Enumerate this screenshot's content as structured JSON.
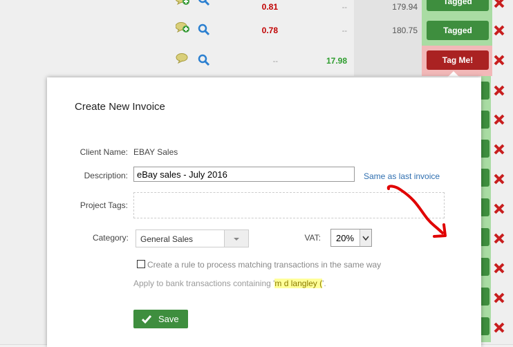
{
  "rows": [
    {
      "c1": "0.81",
      "c2": "--",
      "c3": "179.94",
      "tag": "Tagged"
    },
    {
      "c1": "0.78",
      "c2": "--",
      "c3": "180.75",
      "tag": "Tagged"
    },
    {
      "c1": "--",
      "c2": "17.98",
      "c3": "",
      "tag": "Tag Me!"
    }
  ],
  "modal": {
    "title": "Create New Invoice",
    "client_label": "Client Name:",
    "client_value": "EBAY Sales",
    "description_label": "Description:",
    "description_value": "eBay sales - July 2016",
    "same_link": "Same as last invoice",
    "tags_label": "Project Tags:",
    "category_label": "Category:",
    "category_value": "General Sales",
    "vat_label": "VAT:",
    "vat_value": "20%",
    "rule_text": "Create a rule to process matching transactions in the same way",
    "apply_prefix": "Apply to bank transactions containing '",
    "apply_match": "m d langley (",
    "apply_suffix": "'.",
    "save_label": "Save"
  },
  "colors": {
    "green": "#3e8e3e",
    "red": "#aa2222",
    "link": "#2f6fb0",
    "highlight": "#ffff99"
  }
}
